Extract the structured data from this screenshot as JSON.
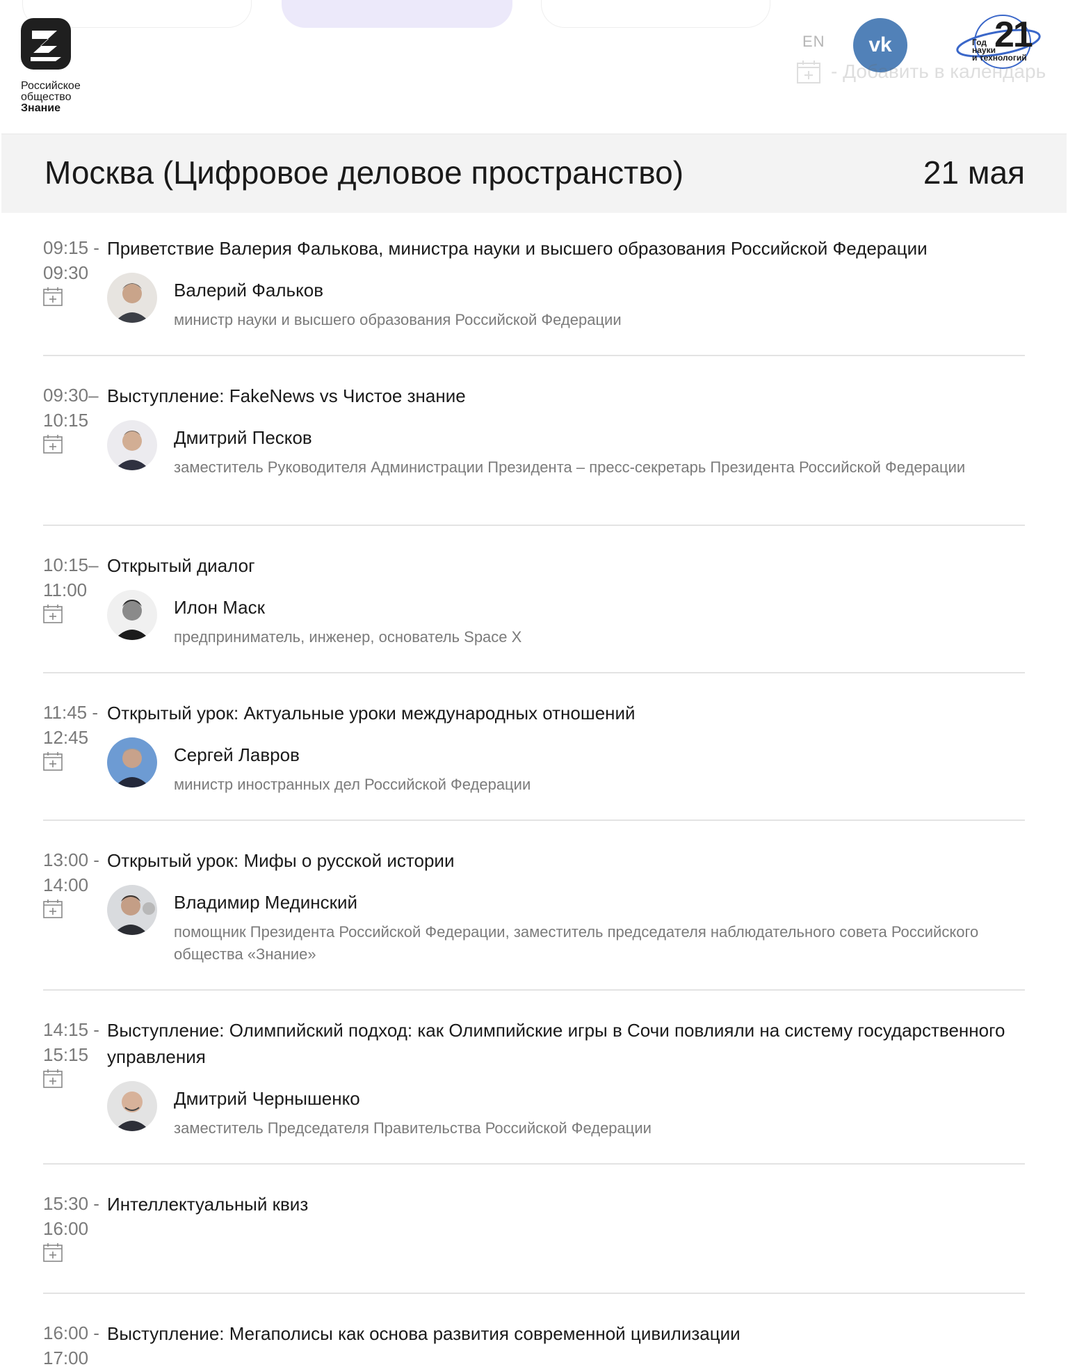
{
  "header": {
    "logo_lines": [
      "Российское",
      "общество",
      "Знание"
    ],
    "lang_label": "EN",
    "vk_label": "vk",
    "year_badge_num": "21",
    "year_badge_lines": [
      "Год",
      "науки",
      "и технологий"
    ],
    "add_to_calendar_label": "- Добавить в календарь"
  },
  "section": {
    "title": "Москва (Цифровое деловое пространство)",
    "date": "21 мая"
  },
  "events": [
    {
      "time_start": "09:15 -",
      "time_end": "09:30",
      "title": "Приветствие Валерия Фалькова, министра науки и высшего образования Российской Федерации",
      "speaker": "Валерий Фальков",
      "role": "министр науки и высшего образования Российской Федерации"
    },
    {
      "time_start": "09:30–",
      "time_end": "10:15",
      "title": "Выступление: FakeNews vs Чистое знание",
      "speaker": "Дмитрий Песков",
      "role": "заместитель Руководителя Администрации Президента – пресс-секретарь Президента Российской Федерации"
    },
    {
      "time_start": "10:15–",
      "time_end": "11:00",
      "title": "Открытый диалог",
      "speaker": "Илон Маск",
      "role": "предприниматель, инженер, основатель Space X"
    },
    {
      "time_start": "11:45 -",
      "time_end": "12:45",
      "title": "Открытый урок: Актуальные уроки международных отношений",
      "speaker": "Сергей Лавров",
      "role": "министр иностранных дел Российской Федерации"
    },
    {
      "time_start": "13:00 -",
      "time_end": "14:00",
      "title": "Открытый урок: Мифы о русской истории",
      "speaker": "Владимир Мединский",
      "role": "помощник Президента Российской Федерации, заместитель председателя наблюдательного совета Российского общества «Знание»"
    },
    {
      "time_start": "14:15 -",
      "time_end": "15:15",
      "title": "Выступление: Олимпийский подход: как Олимпийские игры в Сочи повлияли на систему государственного управления",
      "speaker": "Дмитрий Чернышенко",
      "role": "заместитель Председателя Правительства Российской Федерации"
    },
    {
      "time_start": "15:30 -",
      "time_end": "16:00",
      "title": "Интеллектуальный квиз"
    },
    {
      "time_start": "16:00 -",
      "time_end": "17:00",
      "title": "Выступление: Мегаполисы как основа развития современной цивилизации"
    }
  ],
  "colors": {
    "accent_pill": "#ece9fa",
    "vk_blue": "#5181b8",
    "section_bg": "#f3f3f3",
    "muted_text": "#7b7b7b"
  }
}
